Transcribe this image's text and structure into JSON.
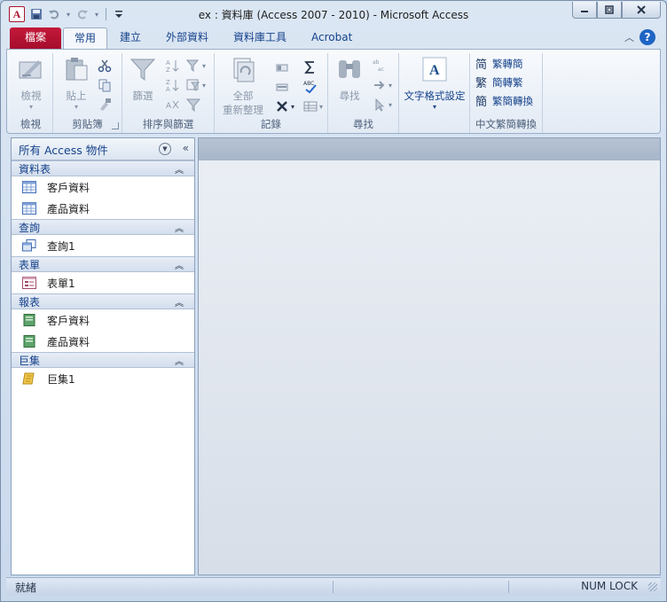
{
  "window": {
    "title": "ex : 資料庫 (Access 2007 - 2010)  -  Microsoft Access",
    "app_icon": "A"
  },
  "ribbon_tabs": [
    {
      "label": "檔案"
    },
    {
      "label": "常用"
    },
    {
      "label": "建立"
    },
    {
      "label": "外部資料"
    },
    {
      "label": "資料庫工具"
    },
    {
      "label": "Acrobat"
    }
  ],
  "ribbon": {
    "groups": {
      "view": "檢視",
      "clipboard": "剪貼簿",
      "sort_filter": "排序與篩選",
      "records": "記錄",
      "find": "尋找",
      "chinese_conversion": "中文繁簡轉換"
    },
    "buttons": {
      "view": "檢視",
      "paste": "貼上",
      "filter": "篩選",
      "refresh_all_line1": "全部",
      "refresh_all_line2": "重新整理",
      "find": "尋找",
      "text_formatting": "文字格式設定",
      "trad_to_simp": "繁轉簡",
      "simp_to_trad": "簡轉繁",
      "trad_simp_convert": "繁簡轉換"
    }
  },
  "nav_pane": {
    "header": "所有 Access 物件",
    "groups": [
      {
        "label": "資料表",
        "items": [
          {
            "label": "客戶資料",
            "icon": "table-icon"
          },
          {
            "label": "產品資料",
            "icon": "table-icon"
          }
        ]
      },
      {
        "label": "查詢",
        "items": [
          {
            "label": "查詢1",
            "icon": "query-icon"
          }
        ]
      },
      {
        "label": "表單",
        "items": [
          {
            "label": "表單1",
            "icon": "form-icon"
          }
        ]
      },
      {
        "label": "報表",
        "items": [
          {
            "label": "客戶資料",
            "icon": "report-icon"
          },
          {
            "label": "產品資料",
            "icon": "report-icon"
          }
        ]
      },
      {
        "label": "巨集",
        "items": [
          {
            "label": "巨集1",
            "icon": "macro-icon"
          }
        ]
      }
    ]
  },
  "status": {
    "left": "就緒",
    "right": "NUM LOCK"
  },
  "colors": {
    "file_tab": "#b8123a",
    "accent": "#15428b",
    "help": "#1f65c4"
  }
}
